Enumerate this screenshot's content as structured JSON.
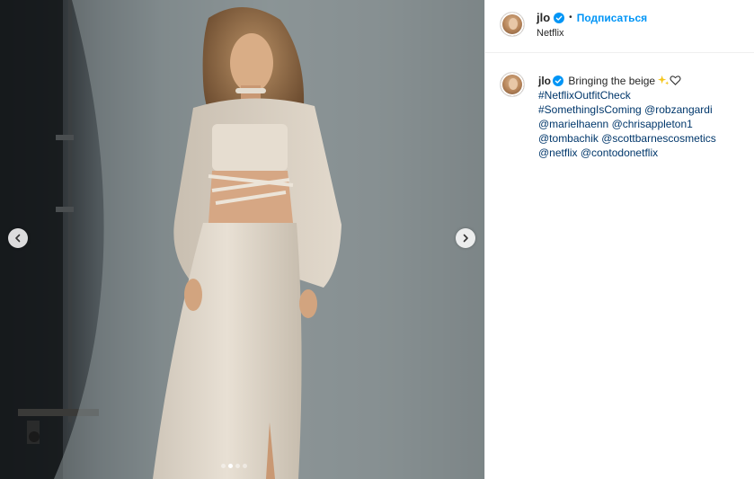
{
  "post": {
    "media": {
      "prev_label": "‹",
      "next_label": "›",
      "carousel_dots": 4,
      "active_dot": 1
    },
    "header": {
      "username": "jlo",
      "separator": "•",
      "follow_label": "Подписаться",
      "location": "Netflix"
    },
    "caption": {
      "username": "jlo",
      "text_lead": "Bringing the beige",
      "line2": "#NetflixOutfitCheck",
      "line3_tag": "#SomethingIsComing",
      "line3_mention": "@robzangardi",
      "line4_mention1": "@marielhaenn",
      "line4_mention2": "@chrisappleton1",
      "line5_mention1": "@tombachik",
      "line5_mention2": "@scottbarnescosmetics",
      "line6_mention1": "@netflix",
      "line6_mention2": "@contodonetflix"
    }
  },
  "colors": {
    "accent": "#0095f6",
    "link": "#00376b",
    "text": "#262626",
    "border": "#efefef"
  },
  "icons": [
    "verified-badge-icon",
    "chevron-left-icon",
    "chevron-right-icon",
    "sparkles-icon",
    "heart-outline-icon"
  ]
}
